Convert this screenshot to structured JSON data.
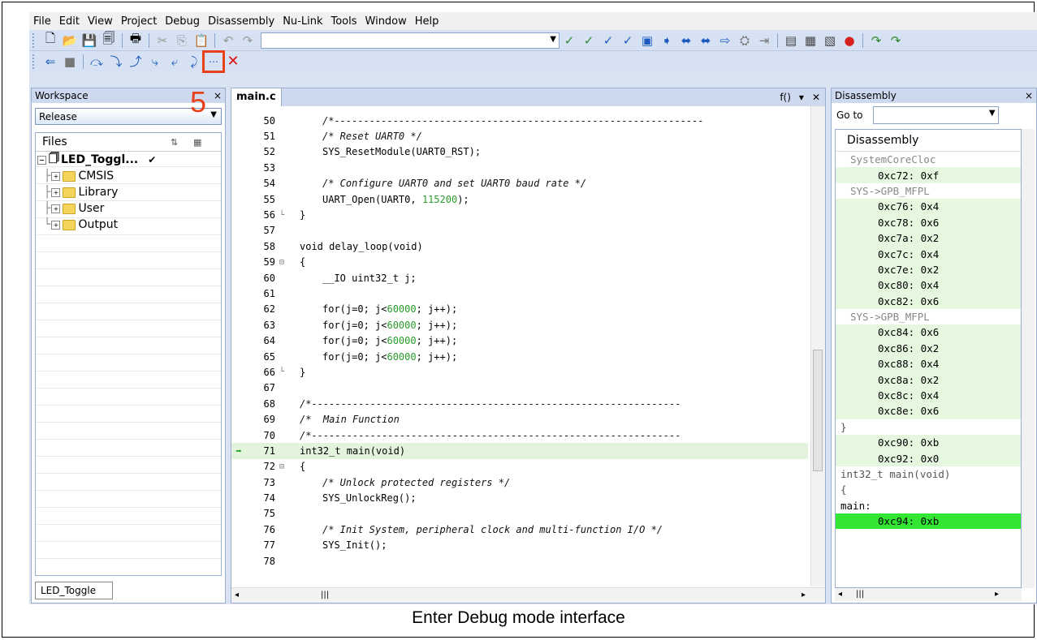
{
  "menu": [
    "File",
    "Edit",
    "View",
    "Project",
    "Debug",
    "Disassembly",
    "Nu-Link",
    "Tools",
    "Window",
    "Help"
  ],
  "icons": {
    "new": "new-file-icon",
    "open": "open-folder-icon",
    "save": "save-icon",
    "save_all": "save-all-icon",
    "print": "print-icon",
    "cut": "cut-icon",
    "copy": "copy-icon",
    "paste": "paste-icon",
    "undo": "undo-icon",
    "redo": "redo-icon",
    "step_into": "step-into-icon",
    "stop_debug": "stop-debug-icon"
  },
  "step_marker": "5",
  "workspace": {
    "title": "Workspace",
    "close": "×",
    "config": "Release",
    "files_header": "Files",
    "tree": [
      {
        "label": "LED_Toggl...",
        "check": "✔",
        "level": 0
      },
      {
        "label": "CMSIS",
        "level": 1
      },
      {
        "label": "Library",
        "level": 1
      },
      {
        "label": "User",
        "level": 1
      },
      {
        "label": "Output",
        "level": 1
      }
    ],
    "bottom_tab": "LED_Toggle"
  },
  "editor": {
    "tab": "main.c",
    "func": "f()",
    "lines": [
      {
        "n": "50",
        "t": "/*---------------------------------------------------------------",
        "c": true
      },
      {
        "n": "51",
        "t": "/* Reset UART0 */",
        "c": true
      },
      {
        "n": "52",
        "t": "SYS_ResetModule(UART0_RST);"
      },
      {
        "n": "53",
        "t": ""
      },
      {
        "n": "54",
        "t": "/* Configure UART0 and set UART0 baud rate */",
        "c": true
      },
      {
        "n": "55",
        "t": "UART_Open(UART0, 115200);",
        "num": "115200"
      },
      {
        "n": "56",
        "t": "}",
        "fold": "└",
        "indent": 0
      },
      {
        "n": "57",
        "t": ""
      },
      {
        "n": "58",
        "t": "void delay_loop(void)",
        "indent": 0
      },
      {
        "n": "59",
        "t": "{",
        "fold": "⊟",
        "indent": 0
      },
      {
        "n": "60",
        "t": "__IO uint32_t j;"
      },
      {
        "n": "61",
        "t": ""
      },
      {
        "n": "62",
        "t": "for(j=0; j<60000; j++);",
        "num": "60000"
      },
      {
        "n": "63",
        "t": "for(j=0; j<60000; j++);",
        "num": "60000"
      },
      {
        "n": "64",
        "t": "for(j=0; j<60000; j++);",
        "num": "60000"
      },
      {
        "n": "65",
        "t": "for(j=0; j<60000; j++);",
        "num": "60000"
      },
      {
        "n": "66",
        "t": "}",
        "fold": "└",
        "indent": 0
      },
      {
        "n": "67",
        "t": ""
      },
      {
        "n": "68",
        "t": "/*---------------------------------------------------------------",
        "c": true,
        "indent": 0
      },
      {
        "n": "69",
        "t": "/*  Main Function",
        "c": true,
        "indent": 0
      },
      {
        "n": "70",
        "t": "/*---------------------------------------------------------------",
        "c": true,
        "indent": 0
      },
      {
        "n": "71",
        "t": "int32_t main(void)",
        "indent": 0,
        "cur": true
      },
      {
        "n": "72",
        "t": "{",
        "fold": "⊟",
        "indent": 0
      },
      {
        "n": "73",
        "t": "/* Unlock protected registers */",
        "c": true
      },
      {
        "n": "74",
        "t": "SYS_UnlockReg();"
      },
      {
        "n": "75",
        "t": ""
      },
      {
        "n": "76",
        "t": "/* Init System, peripheral clock and multi-function I/O */",
        "c": true
      },
      {
        "n": "77",
        "t": "SYS_Init();"
      },
      {
        "n": "78",
        "t": ""
      }
    ]
  },
  "disassembly": {
    "title": "Disassembly",
    "close": "×",
    "goto_label": "Go to",
    "list_title": "Disassembly",
    "rows": [
      {
        "k": "src",
        "t": "SystemCoreCloc"
      },
      {
        "k": "asm",
        "t": "0xc72: 0xf"
      },
      {
        "k": "src",
        "t": "SYS->GPB_MFPL"
      },
      {
        "k": "asm",
        "t": "0xc76: 0x4"
      },
      {
        "k": "asm",
        "t": "0xc78: 0x6"
      },
      {
        "k": "asm",
        "t": "0xc7a: 0x2"
      },
      {
        "k": "asm",
        "t": "0xc7c: 0x4"
      },
      {
        "k": "asm",
        "t": "0xc7e: 0x2"
      },
      {
        "k": "asm",
        "t": "0xc80: 0x4"
      },
      {
        "k": "asm",
        "t": "0xc82: 0x6"
      },
      {
        "k": "src",
        "t": "SYS->GPB_MFPL"
      },
      {
        "k": "asm",
        "t": "0xc84: 0x6"
      },
      {
        "k": "asm",
        "t": "0xc86: 0x2"
      },
      {
        "k": "asm",
        "t": "0xc88: 0x4"
      },
      {
        "k": "asm",
        "t": "0xc8a: 0x2"
      },
      {
        "k": "asm",
        "t": "0xc8c: 0x4"
      },
      {
        "k": "asm",
        "t": "0xc8e: 0x6"
      },
      {
        "k": "plain",
        "t": "}"
      },
      {
        "k": "asm",
        "t": "0xc90: 0xb"
      },
      {
        "k": "asm",
        "t": "0xc92: 0x0"
      },
      {
        "k": "plain",
        "t": "int32_t main(void)"
      },
      {
        "k": "plain",
        "t": "{"
      },
      {
        "k": "label",
        "t": "main:"
      },
      {
        "k": "cur",
        "t": "0xc94: 0xb"
      }
    ]
  },
  "caption": "Enter Debug mode interface"
}
